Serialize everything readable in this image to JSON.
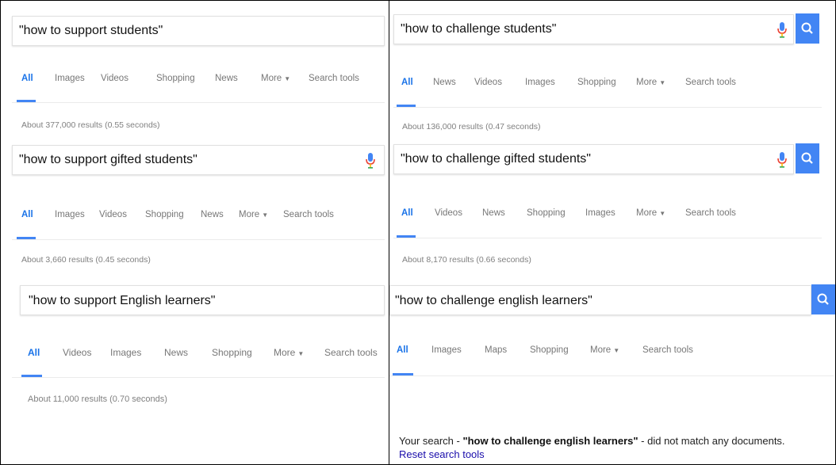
{
  "left": {
    "blocks": [
      {
        "query": "\"how to support students\"",
        "tabs": [
          "All",
          "Images",
          "Videos",
          "Shopping",
          "News",
          "More",
          "Search tools"
        ],
        "stats": "About 377,000 results (0.55 seconds)"
      },
      {
        "query": "\"how to support gifted students\"",
        "tabs": [
          "All",
          "Images",
          "Videos",
          "Shopping",
          "News",
          "More",
          "Search tools"
        ],
        "stats": "About 3,660 results (0.45 seconds)"
      },
      {
        "query": "\"how to support English learners\"",
        "tabs": [
          "All",
          "Videos",
          "Images",
          "News",
          "Shopping",
          "More",
          "Search tools"
        ],
        "stats": "About 11,000 results (0.70 seconds)"
      }
    ]
  },
  "right": {
    "blocks": [
      {
        "query": "\"how to challenge students\"",
        "tabs": [
          "All",
          "News",
          "Videos",
          "Images",
          "Shopping",
          "More",
          "Search tools"
        ],
        "stats": "About 136,000 results (0.47 seconds)"
      },
      {
        "query": "\"how to challenge gifted students\"",
        "tabs": [
          "All",
          "Videos",
          "News",
          "Shopping",
          "Images",
          "More",
          "Search tools"
        ],
        "stats": "About 8,170 results (0.66 seconds)"
      },
      {
        "query": "\"how to challenge english learners\"",
        "tabs": [
          "All",
          "Images",
          "Maps",
          "Shopping",
          "More",
          "Search tools"
        ],
        "nomatch_prefix": "Your search - ",
        "nomatch_query": "\"how to challenge english learners\"",
        "nomatch_suffix": " - did not match any documents.",
        "reset_link": "Reset search tools"
      }
    ]
  },
  "colors": {
    "accent": "#4285f4",
    "active_tab": "#1a73e8",
    "link": "#1a0dab",
    "muted": "#808080"
  },
  "icons": [
    "microphone-icon",
    "search-magnifier-icon",
    "caret-down-icon"
  ]
}
